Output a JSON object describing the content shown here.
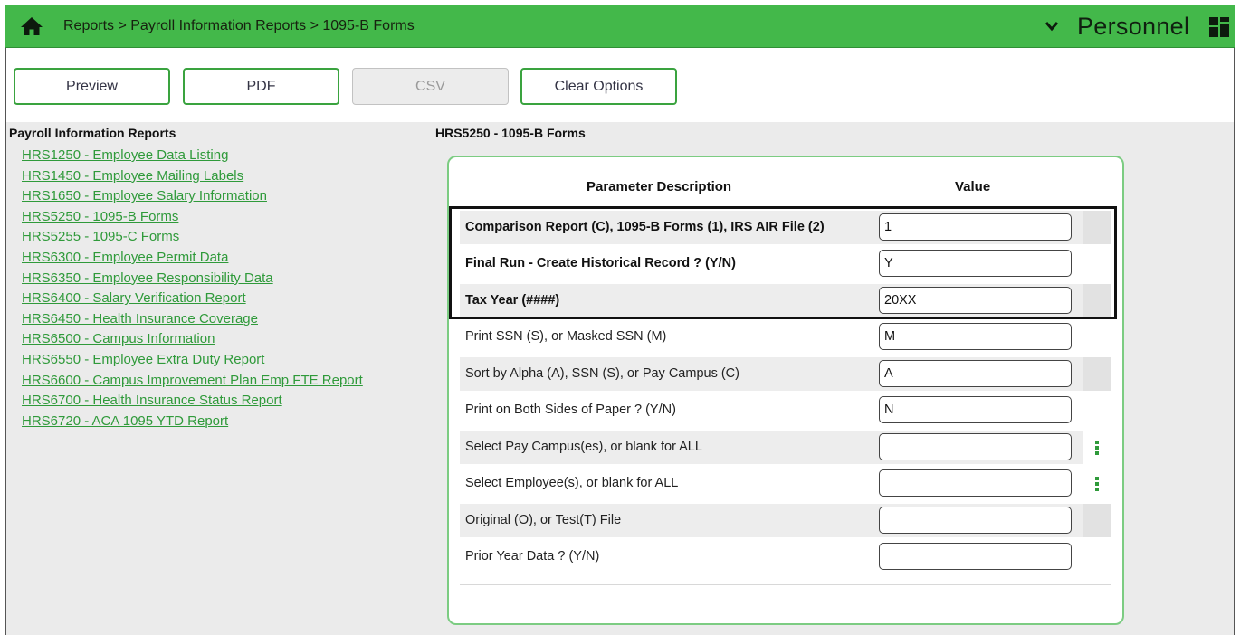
{
  "header": {
    "breadcrumb": "Reports > Payroll Information Reports > 1095-B Forms",
    "module": "Personnel",
    "icons": [
      "home-icon",
      "chevron-down-icon",
      "grid-icon"
    ],
    "color": "#43b84a"
  },
  "toolbar": {
    "preview_label": "Preview",
    "pdf_label": "PDF",
    "csv_label": "CSV",
    "clear_label": "Clear Options"
  },
  "sidebar": {
    "title": "Payroll Information Reports",
    "items": [
      {
        "label": "HRS1250 - Employee Data Listing"
      },
      {
        "label": "HRS1450 - Employee Mailing Labels"
      },
      {
        "label": "HRS1650 - Employee Salary Information"
      },
      {
        "label": "HRS5250 - 1095-B Forms"
      },
      {
        "label": "HRS5255 - 1095-C Forms"
      },
      {
        "label": "HRS6300 - Employee Permit Data"
      },
      {
        "label": "HRS6350 - Employee Responsibility Data"
      },
      {
        "label": "HRS6400 - Salary Verification Report"
      },
      {
        "label": "HRS6450 - Health Insurance Coverage"
      },
      {
        "label": "HRS6500 - Campus Information"
      },
      {
        "label": "HRS6550 - Employee Extra Duty Report"
      },
      {
        "label": "HRS6600 - Campus Improvement Plan Emp FTE Report"
      },
      {
        "label": "HRS6700 - Health Insurance Status Report"
      },
      {
        "label": "HRS6720 - ACA 1095 YTD Report"
      }
    ]
  },
  "form": {
    "title": "HRS5250 - 1095-B Forms",
    "col_description": "Parameter Description",
    "col_value": "Value",
    "params": [
      {
        "description": "Comparison Report (C), 1095-B Forms (1), IRS AIR File (2)",
        "value": "1"
      },
      {
        "description": "Final Run - Create Historical Record ? (Y/N)",
        "value": "Y"
      },
      {
        "description": "Tax Year (####)",
        "value": "20XX"
      },
      {
        "description": "Print SSN (S), or Masked SSN (M)",
        "value": "M"
      },
      {
        "description": "Sort by Alpha (A), SSN (S), or Pay Campus (C)",
        "value": "A"
      },
      {
        "description": "Print on Both Sides of Paper ? (Y/N)",
        "value": "N"
      },
      {
        "description": "Select Pay Campus(es), or blank for ALL",
        "value": ""
      },
      {
        "description": "Select Employee(s), or blank for ALL",
        "value": ""
      },
      {
        "description": "Original (O), or Test(T) File",
        "value": ""
      },
      {
        "description": "Prior Year Data ? (Y/N)",
        "value": ""
      }
    ]
  }
}
